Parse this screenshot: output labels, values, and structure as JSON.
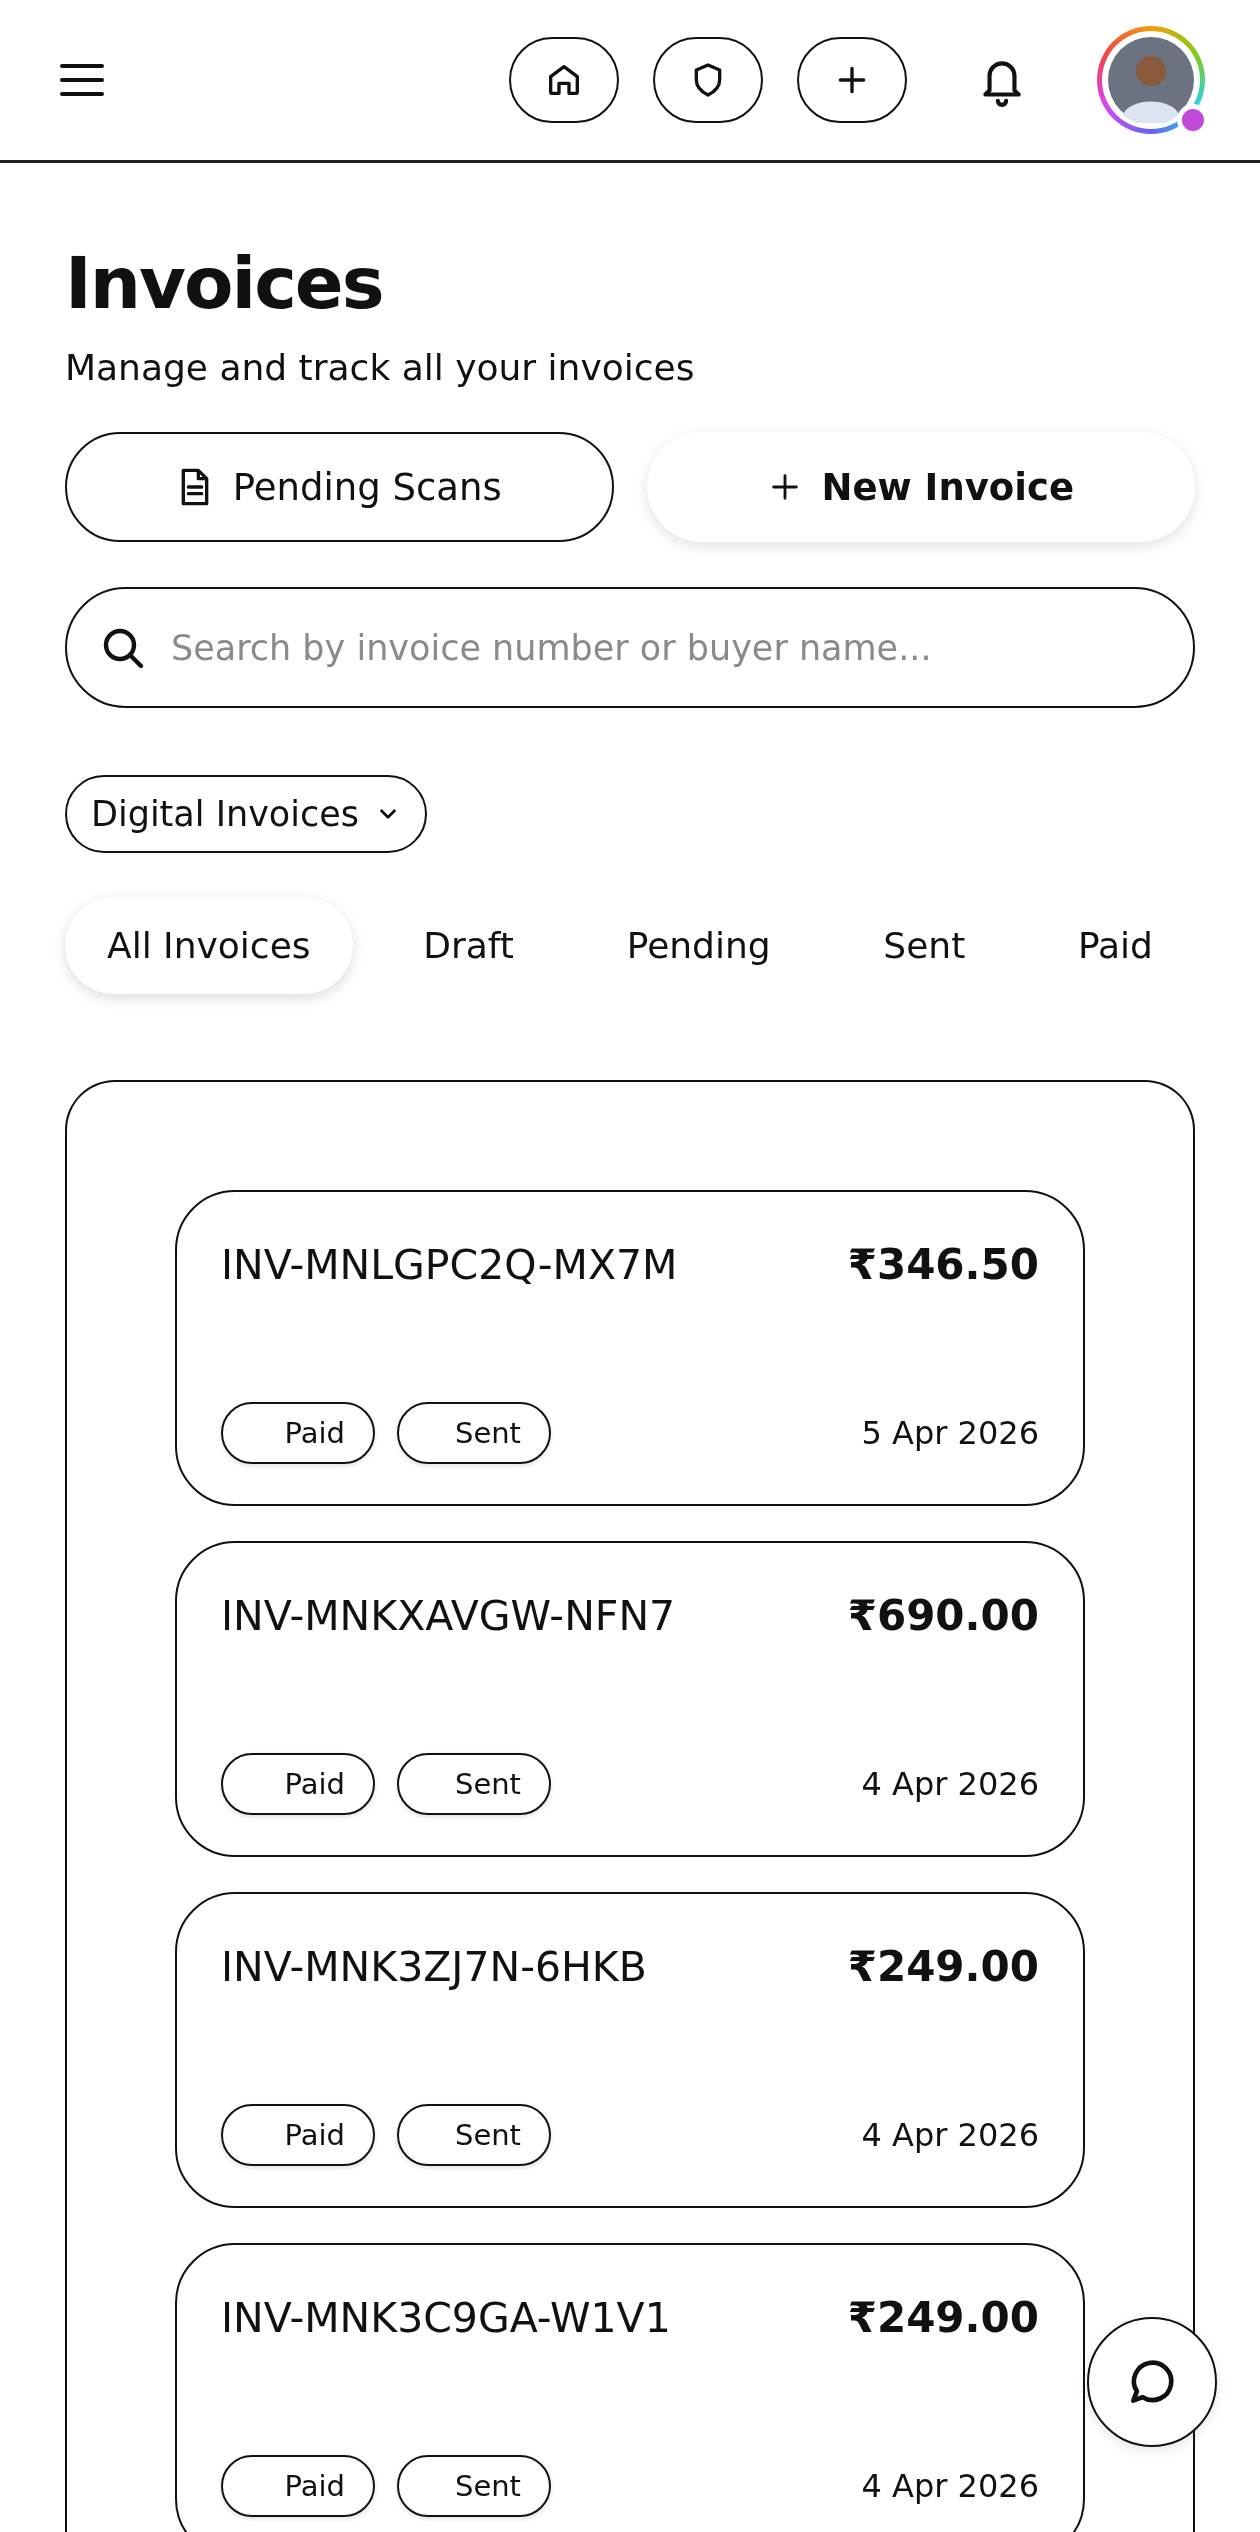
{
  "header": {
    "nav_buttons": [
      {
        "kind": "home"
      },
      {
        "kind": "shield"
      },
      {
        "kind": "plus"
      }
    ]
  },
  "title": "Invoices",
  "subtitle": "Manage and track all your invoices",
  "actions": [
    {
      "kind": "scans",
      "label": "Pending Scans"
    },
    {
      "kind": "new",
      "label": "New Invoice"
    }
  ],
  "search": {
    "placeholder": "Search by invoice number or buyer name..."
  },
  "filter": {
    "value": "Digital Invoices"
  },
  "tabs": [
    {
      "label": "All Invoices",
      "selected": true
    },
    {
      "label": "Draft",
      "selected": false
    },
    {
      "label": "Pending",
      "selected": false
    },
    {
      "label": "Sent",
      "selected": false
    },
    {
      "label": "Paid",
      "selected": false
    }
  ],
  "invoices": [
    {
      "number": "INV-MNLGPC2Q-MX7M",
      "amount": "₹346.50",
      "tags": [
        "Paid",
        "Sent"
      ],
      "date": "5 Apr 2026"
    },
    {
      "number": "INV-MNKXAVGW-NFN7",
      "amount": "₹690.00",
      "tags": [
        "Paid",
        "Sent"
      ],
      "date": "4 Apr 2026"
    },
    {
      "number": "INV-MNK3ZJ7N-6HKB",
      "amount": "₹249.00",
      "tags": [
        "Paid",
        "Sent"
      ],
      "date": "4 Apr 2026"
    },
    {
      "number": "INV-MNK3C9GA-W1V1",
      "amount": "₹249.00",
      "tags": [
        "Paid",
        "Sent"
      ],
      "date": "4 Apr 2026"
    }
  ]
}
